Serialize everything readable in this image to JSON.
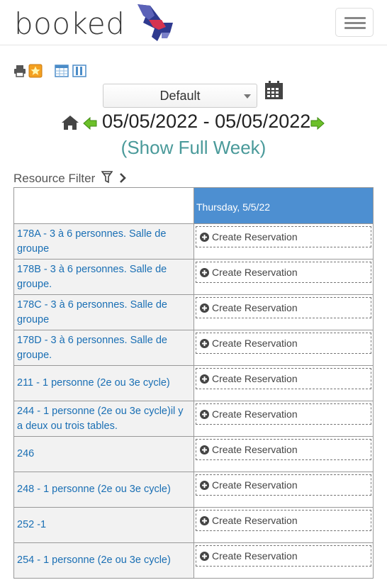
{
  "brand": {
    "name": "booked"
  },
  "header": {
    "menu_icon": "hamburger-menu-icon"
  },
  "toolbar": {
    "icons": [
      "print-icon",
      "favorite-star-icon",
      "calendar-grid-view-icon",
      "column-view-icon"
    ]
  },
  "layout_select": {
    "selected": "Default"
  },
  "date_nav": {
    "range": "05/05/2022 - 05/05/2022",
    "show_full_week": "(Show Full Week)"
  },
  "resource_filter": {
    "label": "Resource Filter"
  },
  "schedule": {
    "day_header": "Thursday, 5/5/22",
    "header_color": "#4d8fd1",
    "create_label": "Create Reservation",
    "resources": [
      "178A - 3 à 6 personnes. Salle de groupe",
      "178B - 3 à 6 personnes. Salle de groupe.",
      "178C - 3 à 6 personnes. Salle de groupe",
      "178D - 3 à 6 personnes. Salle de groupe.",
      "211 - 1 personne (2e ou 3e cycle)",
      "244 - 1 personne (2e ou 3e cycle)il y a deux ou trois tables.",
      "246",
      "248 - 1 personne (2e ou 3e cycle)",
      "252 -1",
      "254 - 1 personne (2e ou 3e cycle)"
    ]
  }
}
